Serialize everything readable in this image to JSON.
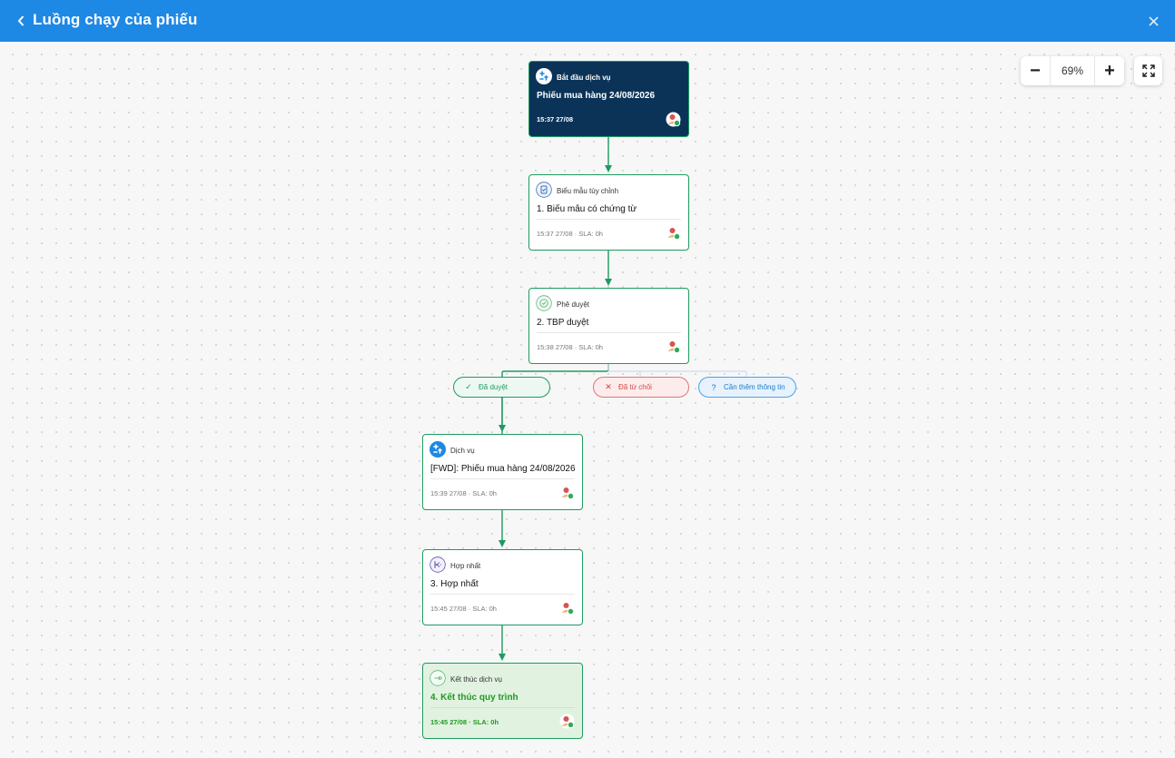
{
  "header": {
    "title": "Luồng chạy của phiếu"
  },
  "zoom": {
    "minus": "−",
    "value": "69%",
    "plus": "+"
  },
  "nodes": [
    {
      "type": "Bắt đầu dịch vụ",
      "name": "Phiếu mua hàng 24/08/2026",
      "meta": "15:37 27/08"
    },
    {
      "type": "Biểu mẫu tùy chỉnh",
      "name": "1. Biểu mẫu có chứng từ",
      "meta": "15:37 27/08 · SLA: 0h"
    },
    {
      "type": "Phê duyệt",
      "name": "2. TBP duyệt",
      "meta": "15:38 27/08 · SLA: 0h"
    },
    {
      "type": "Dịch vụ",
      "name": "[FWD]: Phiếu mua hàng 24/08/2026",
      "meta": "15:39 27/08 · SLA: 0h"
    },
    {
      "type": "Hợp nhất",
      "name": "3. Hợp nhất",
      "meta": "15:45 27/08 · SLA: 0h"
    },
    {
      "type": "Kết thúc dịch vụ",
      "name": "4. Kết thúc quy trình",
      "meta": "15:45 27/08 · SLA: 0h"
    }
  ],
  "branches": {
    "approved": {
      "label": "Đã duyệt",
      "icon": "✓"
    },
    "rejected": {
      "label": "Đã từ chối",
      "icon": "✕"
    },
    "info": {
      "label": "Cần thêm thông tin",
      "icon": "?"
    }
  },
  "colors": {
    "header": "#1e88e5",
    "accent": "#1e9b5f",
    "start_node": "#0b3358",
    "end_node": "#e1f2e1",
    "rejected": "#d64545",
    "info": "#1e7ac8"
  }
}
